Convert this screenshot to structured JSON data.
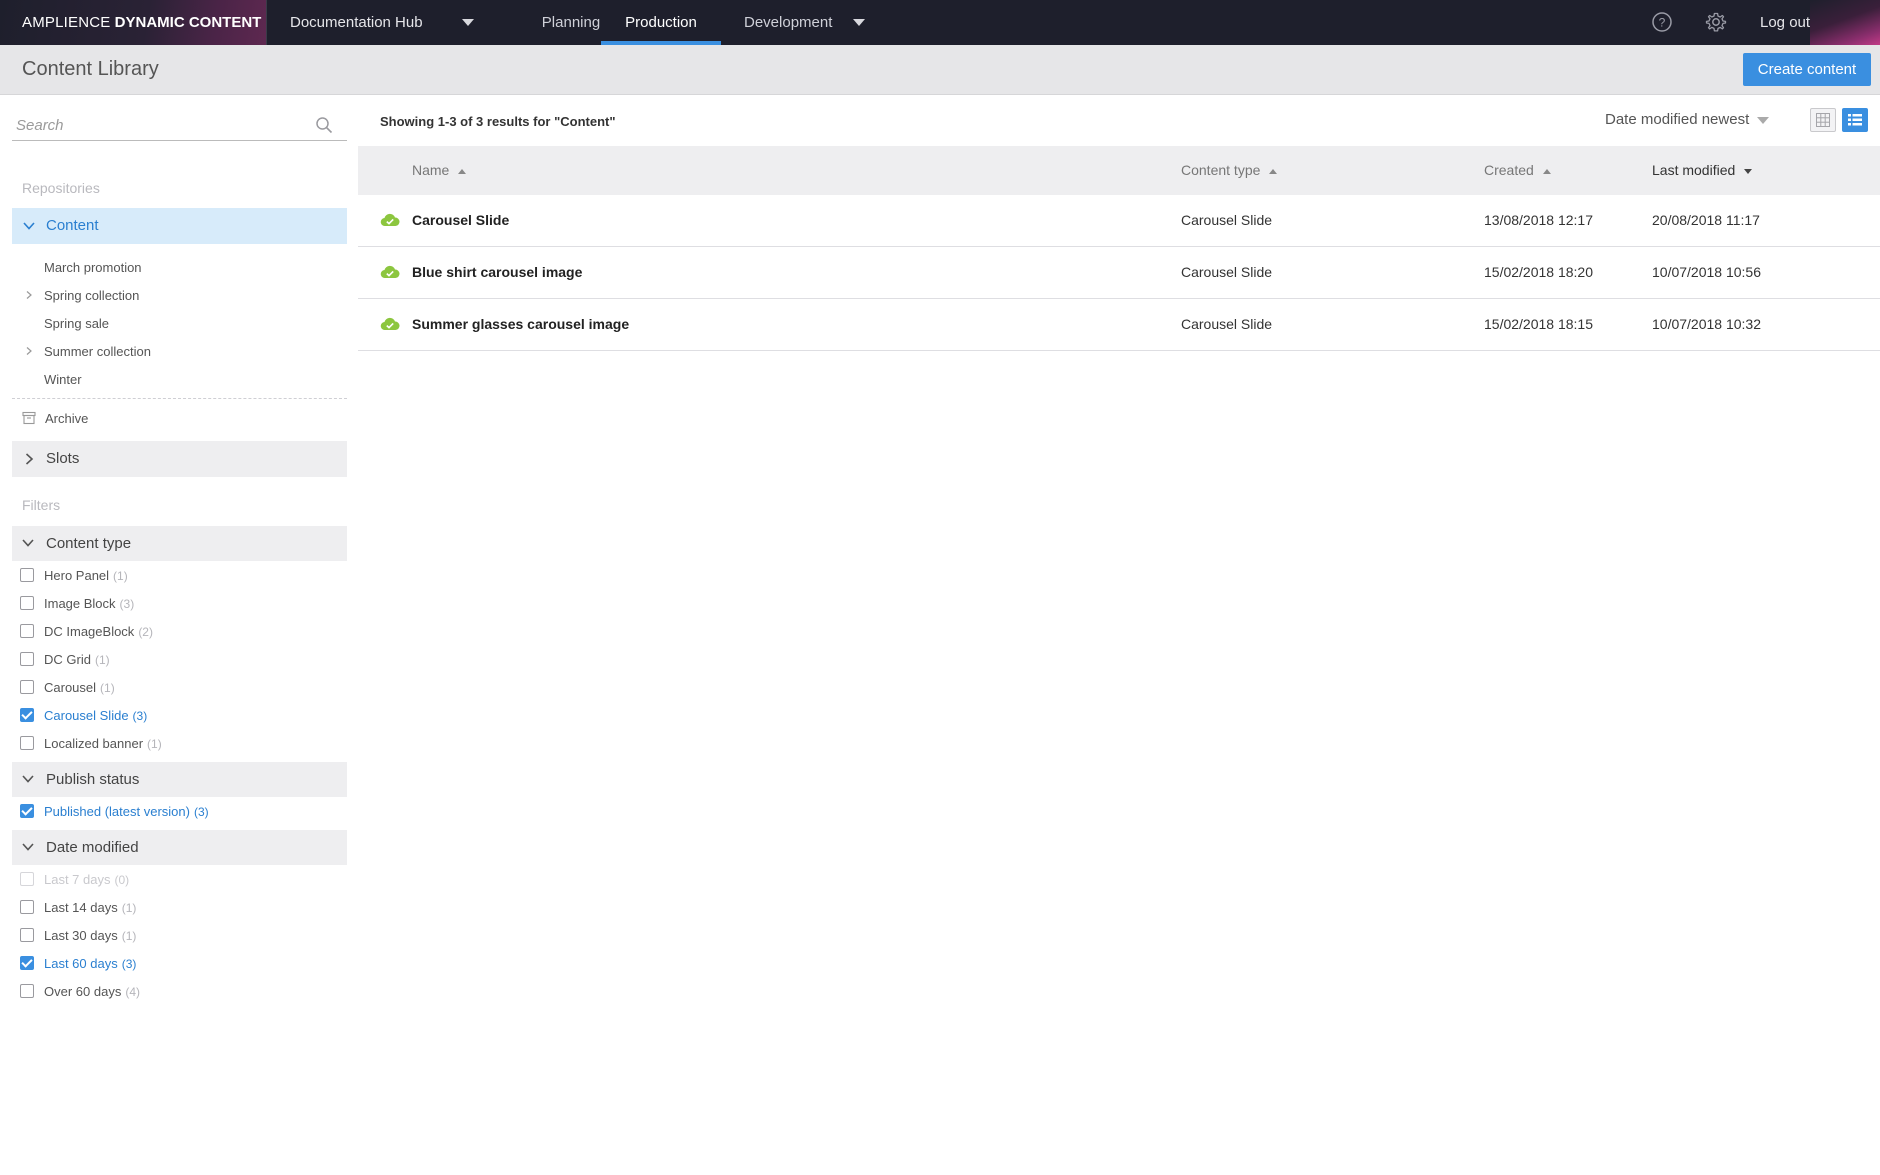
{
  "brand": {
    "light": "AMPLIENCE",
    "bold": "DYNAMIC CONTENT"
  },
  "topnav": {
    "hub": "Documentation Hub",
    "tabs": [
      {
        "label": "Planning",
        "active": false
      },
      {
        "label": "Production",
        "active": true
      },
      {
        "label": "Development",
        "active": false
      }
    ],
    "logout": "Log out",
    "icons": [
      "help-icon",
      "settings-gear-icon"
    ]
  },
  "page": {
    "title": "Content Library",
    "create_button": "Create content"
  },
  "sidebar": {
    "search_placeholder": "Search",
    "repositories_label": "Repositories",
    "selected_repo": "Content",
    "folders": [
      {
        "label": "March promotion",
        "expandable": false
      },
      {
        "label": "Spring collection",
        "expandable": true
      },
      {
        "label": "Spring sale",
        "expandable": false
      },
      {
        "label": "Summer collection",
        "expandable": true
      },
      {
        "label": "Winter",
        "expandable": false
      }
    ],
    "archive": "Archive",
    "slots": "Slots",
    "filters_label": "Filters",
    "content_type": {
      "title": "Content type",
      "items": [
        {
          "label": "Hero Panel",
          "count": "(1)",
          "checked": false
        },
        {
          "label": "Image Block",
          "count": "(3)",
          "checked": false
        },
        {
          "label": "DC ImageBlock",
          "count": "(2)",
          "checked": false
        },
        {
          "label": "DC Grid",
          "count": "(1)",
          "checked": false
        },
        {
          "label": "Carousel",
          "count": "(1)",
          "checked": false
        },
        {
          "label": "Carousel Slide",
          "count": "(3)",
          "checked": true
        },
        {
          "label": "Localized banner",
          "count": "(1)",
          "checked": false
        }
      ]
    },
    "publish_status": {
      "title": "Publish status",
      "items": [
        {
          "label": "Published (latest version)",
          "count": "(3)",
          "checked": true
        }
      ]
    },
    "date_modified": {
      "title": "Date modified",
      "items": [
        {
          "label": "Last 7 days",
          "count": "(0)",
          "checked": false
        },
        {
          "label": "Last 14 days",
          "count": "(1)",
          "checked": false
        },
        {
          "label": "Last 30 days",
          "count": "(1)",
          "checked": false
        },
        {
          "label": "Last 60 days",
          "count": "(3)",
          "checked": true
        },
        {
          "label": "Over 60 days",
          "count": "(4)",
          "checked": false
        }
      ]
    }
  },
  "main": {
    "results_text": "Showing 1-3 of 3 results for \"Content\"",
    "sort_label": "Date modified newest",
    "columns": [
      "Name",
      "Content type",
      "Created",
      "Last modified"
    ],
    "rows": [
      {
        "name": "Carousel Slide",
        "type": "Carousel Slide",
        "created": "13/08/2018 12:17",
        "modified": "20/08/2018 11:17"
      },
      {
        "name": "Blue shirt carousel image",
        "type": "Carousel Slide",
        "created": "15/02/2018 18:20",
        "modified": "10/07/2018 10:56"
      },
      {
        "name": "Summer glasses carousel image",
        "type": "Carousel Slide",
        "created": "15/02/2018 18:15",
        "modified": "10/07/2018 10:32"
      }
    ]
  },
  "colors": {
    "accent": "#3a8fe0",
    "nav_bg": "#1e1f2c",
    "published_green": "#8cc63f"
  }
}
